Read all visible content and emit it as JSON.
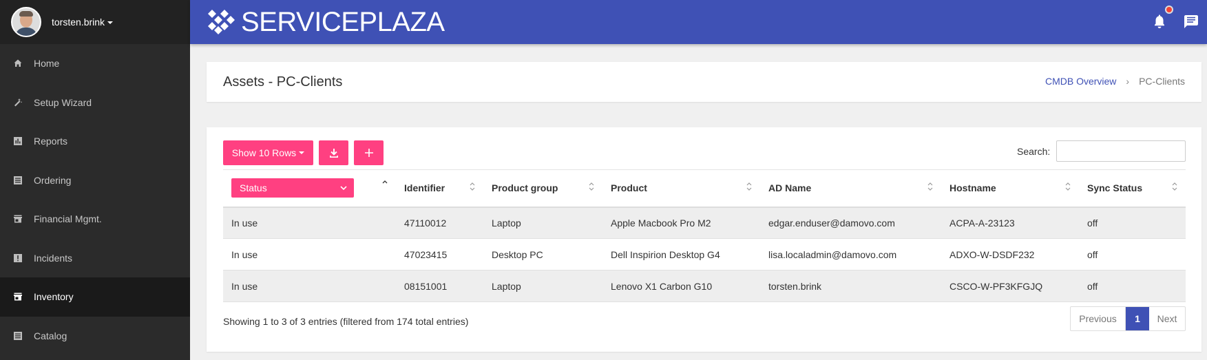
{
  "user": {
    "name": "torsten.brink"
  },
  "sidebar": {
    "items": [
      {
        "label": "Home",
        "icon": "home-icon"
      },
      {
        "label": "Setup Wizard",
        "icon": "wand-icon"
      },
      {
        "label": "Reports",
        "icon": "chart-icon"
      },
      {
        "label": "Ordering",
        "icon": "list-icon"
      },
      {
        "label": "Financial Mgmt.",
        "icon": "store-icon"
      },
      {
        "label": "Incidents",
        "icon": "alert-icon"
      },
      {
        "label": "Inventory",
        "icon": "store-icon",
        "active": true
      },
      {
        "label": "Catalog",
        "icon": "list-icon"
      }
    ]
  },
  "topbar": {
    "brand": "SERVICEPLAZA",
    "color": "#3f51b5"
  },
  "header": {
    "title": "Assets - PC-Clients",
    "breadcrumb": {
      "link": "CMDB Overview",
      "sep": "›",
      "current": "PC-Clients"
    }
  },
  "toolbar": {
    "rows_label": "Show 10 Rows",
    "search_label": "Search:",
    "search_value": ""
  },
  "table": {
    "status_filter": "Status",
    "columns": [
      "Identifier",
      "Product group",
      "Product",
      "AD Name",
      "Hostname",
      "Sync Status"
    ],
    "rows": [
      {
        "status": "In use",
        "identifier": "47110012",
        "group": "Laptop",
        "product": "Apple Macbook Pro M2",
        "ad": "edgar.enduser@damovo.com",
        "host": "ACPA-A-23123",
        "sync": "off"
      },
      {
        "status": "In use",
        "identifier": "47023415",
        "group": "Desktop PC",
        "product": "Dell Inspirion Desktop G4",
        "ad": "lisa.localadmin@damovo.com",
        "host": "ADXO-W-DSDF232",
        "sync": "off"
      },
      {
        "status": "In use",
        "identifier": "08151001",
        "group": "Laptop",
        "product": "Lenovo X1 Carbon G10",
        "ad": "torsten.brink",
        "host": "CSCO-W-PF3KFGJQ",
        "sync": "off"
      }
    ]
  },
  "footer": {
    "info": "Showing 1 to 3 of 3 entries (filtered from 174 total entries)",
    "prev": "Previous",
    "page": "1",
    "next": "Next"
  },
  "colors": {
    "accent": "#ff4081",
    "primary": "#3f51b5",
    "sidebar": "#2b2b2b"
  }
}
